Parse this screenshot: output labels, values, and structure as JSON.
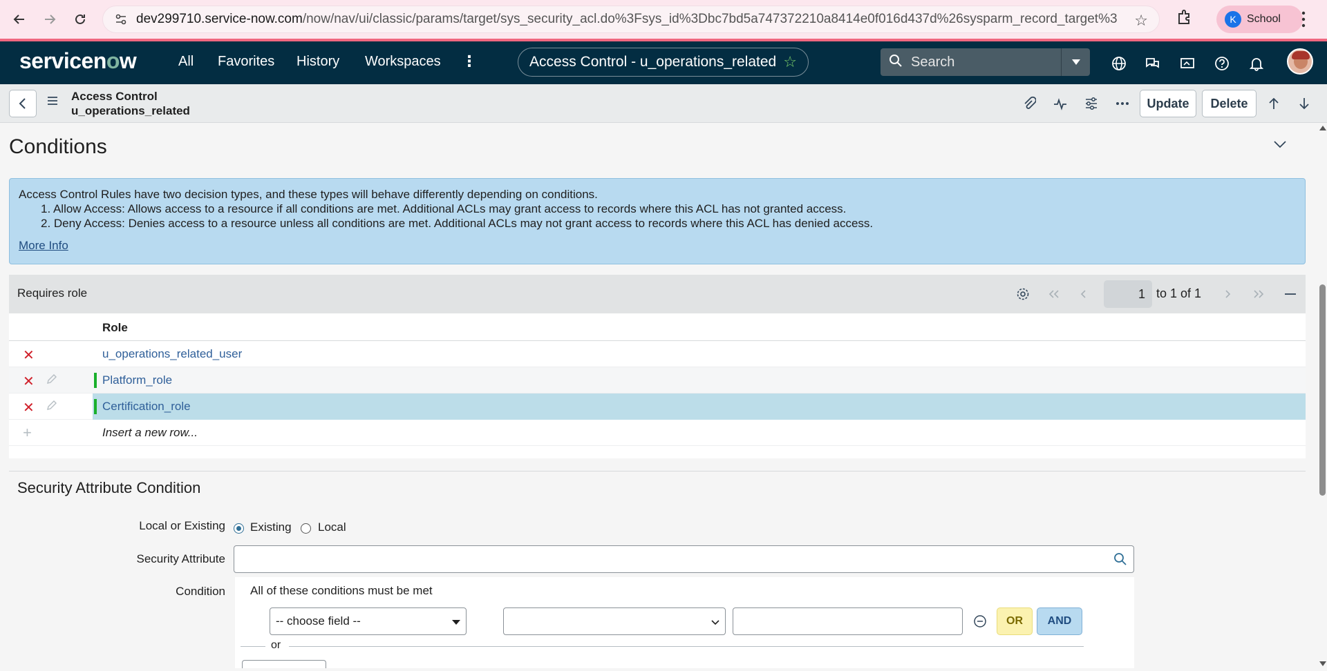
{
  "browser": {
    "url_host": "dev299710.service-now.com",
    "url_path": "/now/nav/ui/classic/params/target/sys_security_acl.do%3Fsys_id%3Dbc7bd5a747372210a8414e0f016d437d%26sysparm_record_target%3Dsys_security_acl...",
    "profile_initial": "K",
    "profile_label": "School"
  },
  "header": {
    "logo_pre": "servicen",
    "logo_o": "o",
    "logo_post": "w",
    "nav": [
      "All",
      "Favorites",
      "History",
      "Workspaces"
    ],
    "context_title": "Access Control - u_operations_related",
    "search_placeholder": "Search"
  },
  "form": {
    "table_label": "Access Control",
    "record_name": "u_operations_related",
    "update_label": "Update",
    "delete_label": "Delete"
  },
  "conditions": {
    "heading": "Conditions",
    "info_intro": "Access Control Rules have two decision types, and these types will behave differently depending on conditions.",
    "info_items": [
      "1. Allow Access: Allows access to a resource if all conditions are met. Additional ACLs may grant access to records where this ACL has not granted access.",
      "2. Deny Access: Denies access to a resource unless all conditions are met. Additional ACLs may not grant access to records where this ACL has denied access."
    ],
    "more_info": "More Info"
  },
  "requires_role": {
    "title": "Requires role",
    "page_value": "1",
    "page_text": "to 1 of 1",
    "column": "Role",
    "rows": [
      "u_operations_related_user",
      "Platform_role",
      "Certification_role"
    ],
    "insert_text": "Insert a new row..."
  },
  "security_attr": {
    "heading": "Security Attribute Condition",
    "local_or_existing_label": "Local or Existing",
    "existing_label": "Existing",
    "local_label": "Local",
    "security_attribute_label": "Security Attribute",
    "condition_label": "Condition",
    "all_conditions": "All of these conditions must be met",
    "choose_field": "-- choose field --",
    "or_label": "OR",
    "and_label": "AND",
    "or_separator": "or"
  },
  "colors": {
    "header_bg": "#032d42",
    "accent_green": "#81b5a1",
    "info_bg": "#b8daf0",
    "selected_row": "#bcdde9",
    "delete_red": "#d0202a"
  }
}
